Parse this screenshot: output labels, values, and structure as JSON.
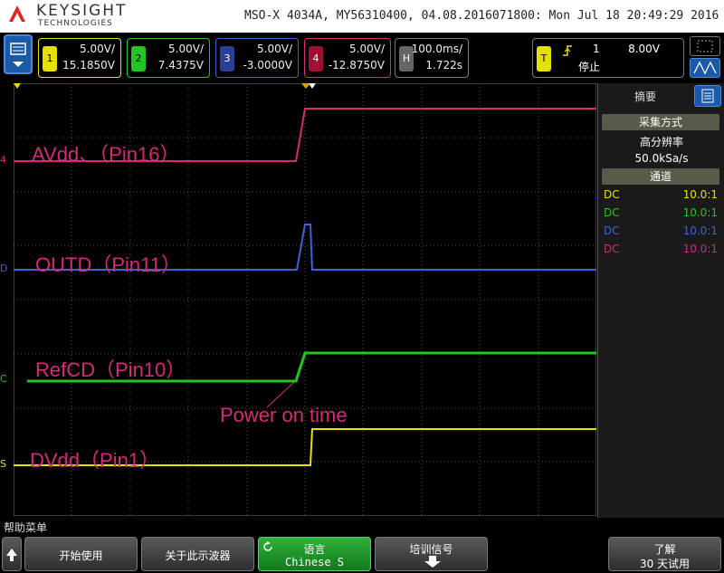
{
  "header": {
    "brand": "KEYSIGHT",
    "brand_sub": "TECHNOLOGIES",
    "info": "MSO-X 4034A, MY56310400, 04.08.2016071800: Mon Jul 18 20:49:29 2016"
  },
  "channels": [
    {
      "num": "1",
      "scale": "5.00V/",
      "offset": "15.1850V",
      "color": "#e8e000"
    },
    {
      "num": "2",
      "scale": "5.00V/",
      "offset": "7.4375V",
      "color": "#22c622"
    },
    {
      "num": "3",
      "scale": "5.00V/",
      "offset": "-3.0000V",
      "color": "#3e62d8"
    },
    {
      "num": "4",
      "scale": "5.00V/",
      "offset": "-12.8750V",
      "color": "#d8287a"
    }
  ],
  "horizontal": {
    "label": "H",
    "scale": "100.0ms/",
    "delay": "1.722s"
  },
  "trigger": {
    "label": "T",
    "source": "1",
    "level": "8.00V",
    "status": "停止"
  },
  "waveforms": {
    "ch4_label": "AVdd、（Pin16）",
    "ch3_label": "OUTD（Pin11）",
    "ch2_label": "RefCD（Pin10）",
    "ch1_label": "DVdd（Pin1）",
    "annotation": "Power on time",
    "marker_ch4": "4",
    "marker_ch3": "D",
    "marker_ch2": "C",
    "marker_ch1": "S"
  },
  "sidebar": {
    "title": "摘要",
    "acq_header": "采集方式",
    "acq_mode": "高分辨率",
    "sample_rate": "50.0kSa/s",
    "channels_header": "通道",
    "rows": [
      {
        "coupling": "DC",
        "probe": "10.0:1",
        "color": "#e8e000"
      },
      {
        "coupling": "DC",
        "probe": "10.0:1",
        "color": "#22c622"
      },
      {
        "coupling": "DC",
        "probe": "10.0:1",
        "color": "#3e62d8"
      },
      {
        "coupling": "DC",
        "probe": "10.0:1",
        "color": "#d8287a"
      }
    ]
  },
  "softkeys": {
    "help_menu": "帮助菜单",
    "get_started": "开始使用",
    "about_scope": "关于此示波器",
    "language_label": "语言",
    "language_value": "Chinese S",
    "training": "培训信号",
    "learn_label": "了解",
    "trial": "30 天试用"
  }
}
